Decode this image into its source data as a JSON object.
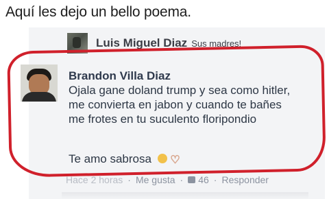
{
  "caption": "Aquí les dejo un bello poema.",
  "post": {
    "author": "Luis Miguel Diaz",
    "text": "Sus madres!"
  },
  "comment": {
    "author": "Brandon Villa Diaz",
    "lines": [
      "Ojala gane doland trump y sea como hitler,",
      "me convierta en jabon y cuando te bañes",
      "me frotes en tu suculento floripondio"
    ],
    "signoff": "Te amo sabrosa"
  },
  "footer": {
    "time": "Hace 2 horas",
    "like": "Me gusta",
    "count": "46",
    "reply": "Responder"
  },
  "colors": {
    "highlight_oval": "#d0202b"
  }
}
